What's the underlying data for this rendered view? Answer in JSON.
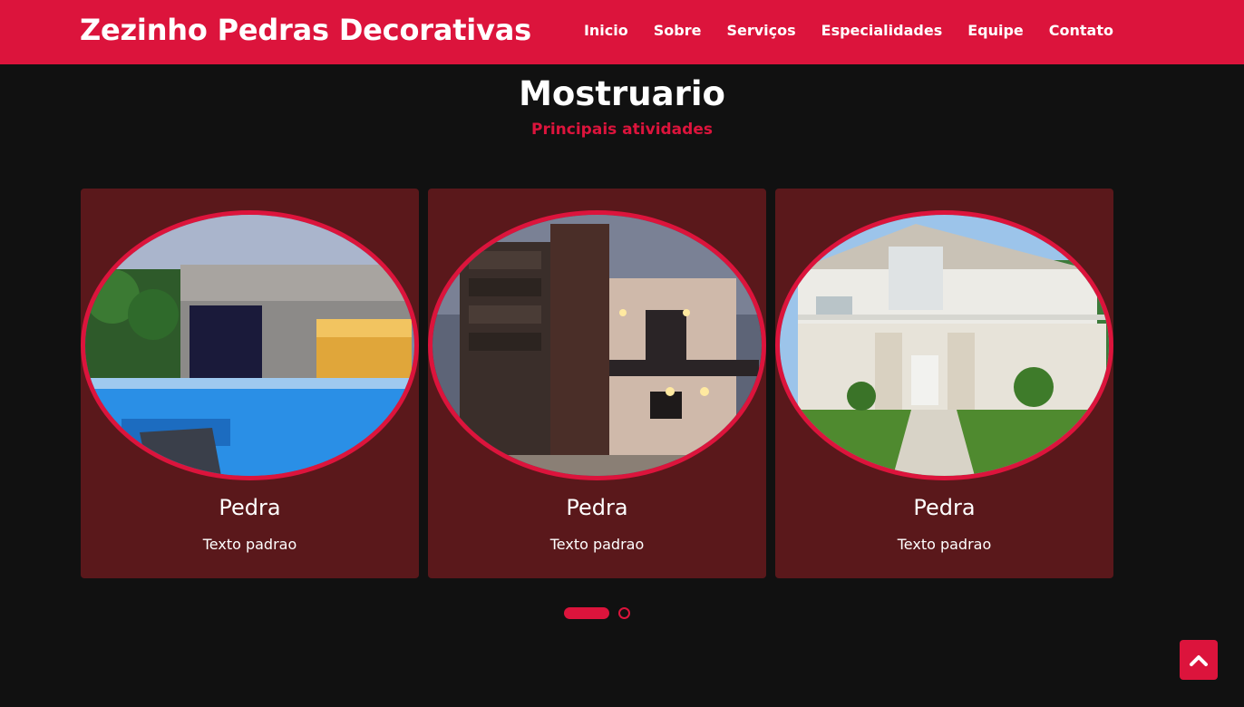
{
  "header": {
    "brand": "Zezinho Pedras Decorativas",
    "nav": [
      {
        "label": "Inicio"
      },
      {
        "label": "Sobre"
      },
      {
        "label": "Serviços"
      },
      {
        "label": "Especialidades"
      },
      {
        "label": "Equipe"
      },
      {
        "label": "Contato"
      }
    ]
  },
  "section": {
    "title": "Mostruario",
    "subtitle": "Principais atividades"
  },
  "cards": [
    {
      "title": "Pedra",
      "text": "Texto padrao",
      "image": "house-with-pool-photo"
    },
    {
      "title": "Pedra",
      "text": "Texto padrao",
      "image": "modern-stone-facade-photo"
    },
    {
      "title": "Pedra",
      "text": "Texto padrao",
      "image": "white-house-garden-photo"
    }
  ],
  "carousel": {
    "active_index": 0,
    "pages": 2
  },
  "back_to_top": {
    "icon": "chevron-up-icon"
  },
  "colors": {
    "accent": "#dc143c",
    "background": "#111111",
    "card": "#5a181b"
  }
}
